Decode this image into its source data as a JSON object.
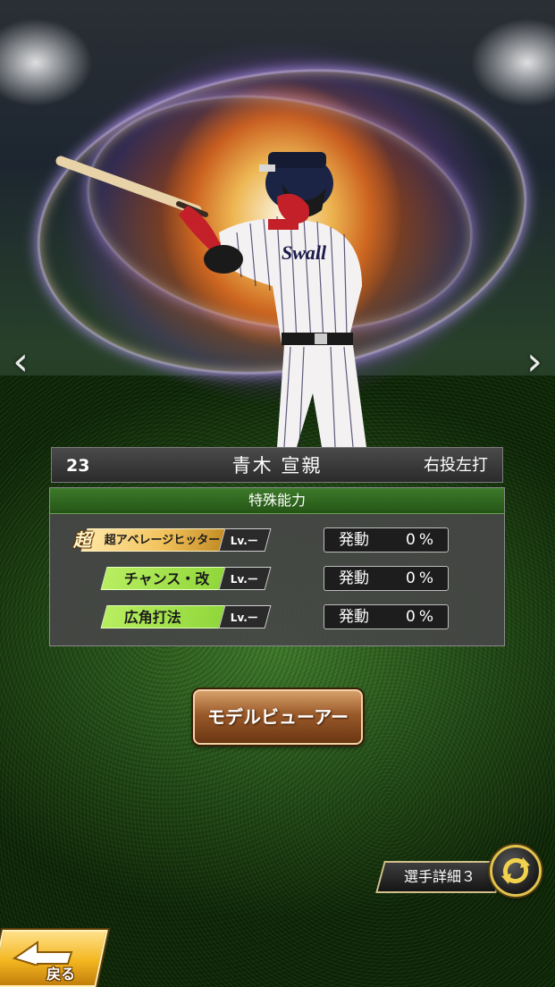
{
  "player": {
    "number": "23",
    "name": "青木 宣親",
    "throw_bat": "右投左打"
  },
  "abilities": {
    "header": "特殊能力",
    "items": [
      {
        "badge": "超",
        "label": "超アベレージヒッター",
        "level": "Lv.ー",
        "trigger_label": "発動",
        "trigger_value": "0%"
      },
      {
        "badge": "",
        "label": "チャンス・改",
        "level": "Lv.ー",
        "trigger_label": "発動",
        "trigger_value": "0%"
      },
      {
        "badge": "",
        "label": "広角打法",
        "level": "Lv.ー",
        "trigger_label": "発動",
        "trigger_value": "0%"
      }
    ]
  },
  "buttons": {
    "model_viewer": "モデルビューアー",
    "detail_tab": "選手詳細３",
    "back": "戻る"
  },
  "nav": {
    "prev_icon": "‹",
    "next_icon": "›"
  },
  "colors": {
    "panel_header": "#2f6a1f",
    "skill_green": "#a6e24a",
    "skill_gold": "#f2c35c",
    "model_button": "#8e4e20",
    "back_button": "#f3b61f"
  }
}
